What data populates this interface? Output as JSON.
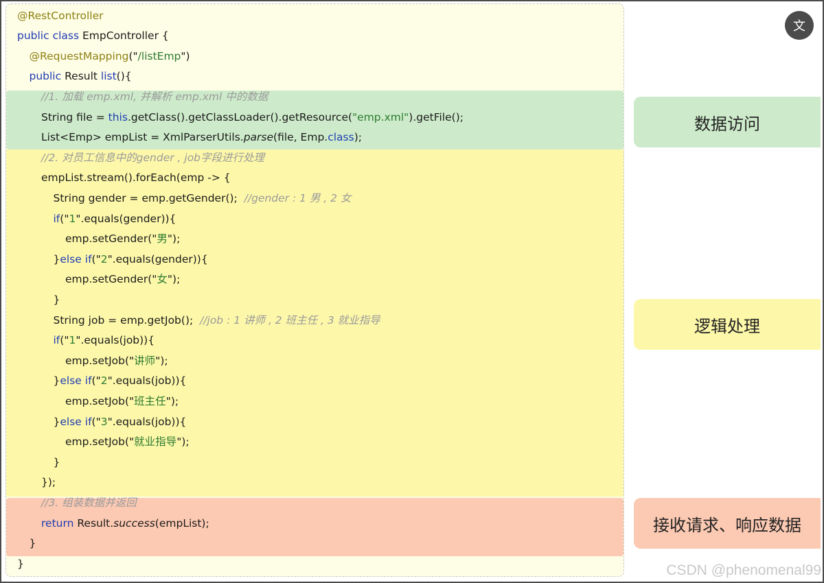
{
  "code": {
    "lines": [
      [
        {
          "t": "@RestController",
          "c": "ann"
        }
      ],
      [
        {
          "t": "public class ",
          "c": "kw"
        },
        {
          "t": "EmpController {"
        }
      ],
      [
        {
          "t": "@RequestMapping",
          "c": "ann"
        },
        {
          "t": "(\""
        },
        {
          "t": "/listEmp",
          "c": "str"
        },
        {
          "t": "\")"
        }
      ],
      [
        {
          "t": "public ",
          "c": "kw"
        },
        {
          "t": "Result "
        },
        {
          "t": "list",
          "c": "kw"
        },
        {
          "t": "(){"
        }
      ],
      [
        {
          "t": "//1. 加载 emp.xml, 并解析 emp.xml 中的数据",
          "c": "cmt"
        }
      ],
      [
        {
          "t": "String file = "
        },
        {
          "t": "this",
          "c": "kw"
        },
        {
          "t": ".getClass().getClassLoader().getResource("
        },
        {
          "t": "\"emp.xml\"",
          "c": "str"
        },
        {
          "t": ").getFile();"
        }
      ],
      [
        {
          "t": "List<Emp> empList = XmlParserUtils."
        },
        {
          "t": "parse",
          "c": "it"
        },
        {
          "t": "(file, Emp."
        },
        {
          "t": "class",
          "c": "kw"
        },
        {
          "t": ");"
        }
      ],
      [
        {
          "t": "//2. 对员工信息中的gender , job字段进行处理",
          "c": "cmt"
        }
      ],
      [
        {
          "t": "empList.stream().forEach(emp -> {"
        }
      ],
      [
        {
          "t": "String gender = emp.getGender();  "
        },
        {
          "t": "//gender : 1 男 , 2 女",
          "c": "cmt"
        }
      ],
      [
        {
          "t": "if",
          "c": "kw"
        },
        {
          "t": "(\""
        },
        {
          "t": "1",
          "c": "str"
        },
        {
          "t": "\".equals(gender)){"
        }
      ],
      [
        {
          "t": "emp.setGender(\""
        },
        {
          "t": "男",
          "c": "str"
        },
        {
          "t": "\");"
        }
      ],
      [
        {
          "t": "}"
        },
        {
          "t": "else if",
          "c": "kw"
        },
        {
          "t": "(\""
        },
        {
          "t": "2",
          "c": "str"
        },
        {
          "t": "\".equals(gender)){"
        }
      ],
      [
        {
          "t": "emp.setGender(\""
        },
        {
          "t": "女",
          "c": "str"
        },
        {
          "t": "\");"
        }
      ],
      [
        {
          "t": "}"
        }
      ],
      [
        {
          "t": "String job = emp.getJob();  "
        },
        {
          "t": "//job : 1 讲师 , 2 班主任 , 3 就业指导",
          "c": "cmt"
        }
      ],
      [
        {
          "t": "if",
          "c": "kw"
        },
        {
          "t": "(\""
        },
        {
          "t": "1",
          "c": "str"
        },
        {
          "t": "\".equals(job)){"
        }
      ],
      [
        {
          "t": "emp.setJob(\""
        },
        {
          "t": "讲师",
          "c": "str"
        },
        {
          "t": "\");"
        }
      ],
      [
        {
          "t": "}"
        },
        {
          "t": "else if",
          "c": "kw"
        },
        {
          "t": "(\""
        },
        {
          "t": "2",
          "c": "str"
        },
        {
          "t": "\".equals(job)){"
        }
      ],
      [
        {
          "t": "emp.setJob(\""
        },
        {
          "t": "班主任",
          "c": "str"
        },
        {
          "t": "\");"
        }
      ],
      [
        {
          "t": "}"
        },
        {
          "t": "else if",
          "c": "kw"
        },
        {
          "t": "(\""
        },
        {
          "t": "3",
          "c": "str"
        },
        {
          "t": "\".equals(job)){"
        }
      ],
      [
        {
          "t": "emp.setJob(\""
        },
        {
          "t": "就业指导",
          "c": "str"
        },
        {
          "t": "\");"
        }
      ],
      [
        {
          "t": "}"
        }
      ],
      [
        {
          "t": "});"
        }
      ],
      [
        {
          "t": "//3. 组装数据并返回",
          "c": "cmt"
        }
      ],
      [
        {
          "t": "return ",
          "c": "kw"
        },
        {
          "t": "Result."
        },
        {
          "t": "success",
          "c": "it"
        },
        {
          "t": "(empList);"
        }
      ],
      [
        {
          "t": "}"
        }
      ],
      [
        {
          "t": "}"
        }
      ]
    ]
  },
  "labels": {
    "access": "数据访问",
    "logic": "逻辑处理",
    "return": "接收请求、响应数据"
  },
  "toolbar": {
    "translate_glyph": "文"
  },
  "watermark": "CSDN @phenomenal99",
  "colors": {
    "card_background": "#fefde6",
    "access_band": "#cdebca",
    "logic_band": "#fdf8a9",
    "return_band": "#fcc9b2",
    "keyword": "#1f3bb3",
    "string": "#2c7a2f",
    "annotation": "#8d8113",
    "comment": "#9a9a9a"
  }
}
